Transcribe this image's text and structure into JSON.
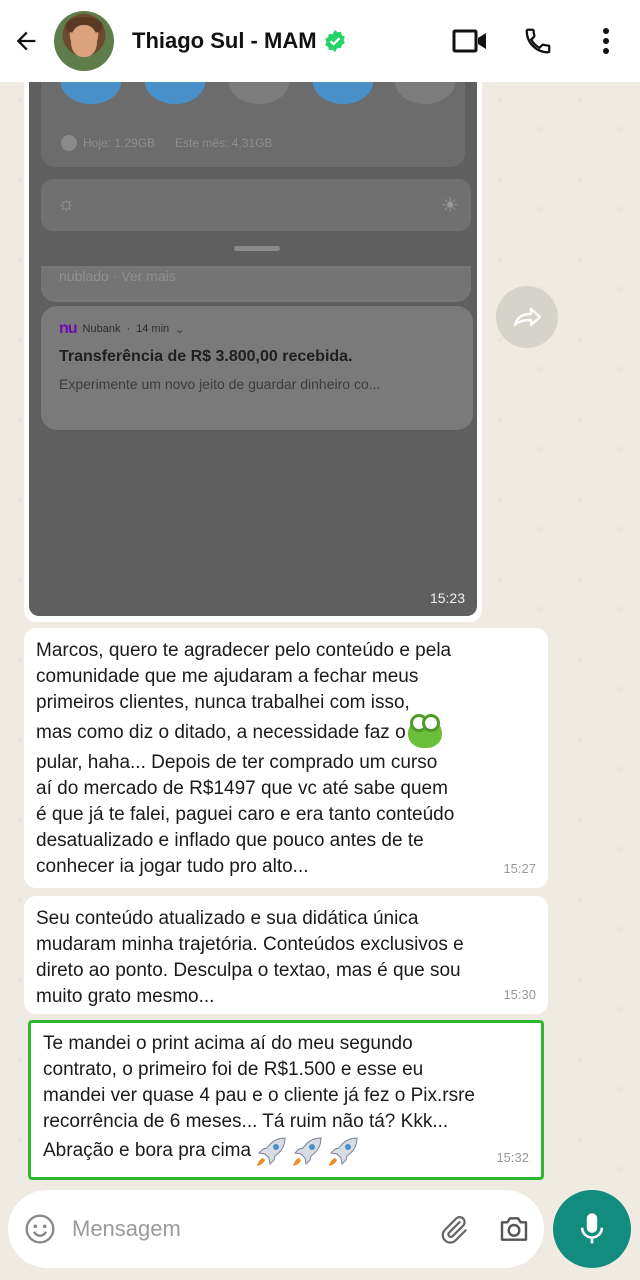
{
  "header": {
    "contact_name": "Thiago Sul - MAM"
  },
  "screenshot_message": {
    "data_usage_today": "Hoje: 1,29GB",
    "data_usage_month": "Este mês: 4,31GB",
    "prev_notification_text": "nublado · Ver mais",
    "notification": {
      "app_name": "Nubank",
      "age": "14 min",
      "title": "Transferência de R$ 3.800,00 recebida.",
      "body": "Experimente um novo jeito de guardar dinheiro co..."
    },
    "time": "15:23"
  },
  "messages": [
    {
      "text_lines": [
        "Marcos, quero te agradecer pelo conteúdo e pela",
        "comunidade que me ajudaram a fechar meus",
        "primeiros clientes, nunca trabalhei com isso,",
        "mas como diz o ditado, a necessidade faz o",
        "pular, haha... Depois de ter comprado um curso",
        "aí do mercado de R$1497 que vc até sabe quem",
        "é que já te falei, paguei caro e era tanto conteúdo",
        "desatualizado e inflado que pouco antes de te",
        "conhecer ia jogar tudo pro alto..."
      ],
      "time": "15:27"
    },
    {
      "text_lines": [
        "Seu conteúdo atualizado e sua didática única",
        "mudaram minha trajetória. Conteúdos exclusivos e",
        "direto ao ponto. Desculpa o textao, mas é que sou",
        "muito grato mesmo..."
      ],
      "time": "15:30"
    },
    {
      "text_lines": [
        "Te mandei o print acima aí do meu segundo",
        "contrato, o primeiro foi de R$1.500 e esse eu",
        "mandei ver quase 4 pau e o cliente já fez o Pix.rsre",
        "recorrência de 6 meses... Tá ruim não tá? Kkk...",
        "Abração e bora pra cima"
      ],
      "time": "15:32"
    }
  ],
  "composer": {
    "placeholder": "Mensagem"
  },
  "colors": {
    "accent": "#128c7e",
    "verified": "#25d366",
    "highlight_border": "#2db92d"
  }
}
